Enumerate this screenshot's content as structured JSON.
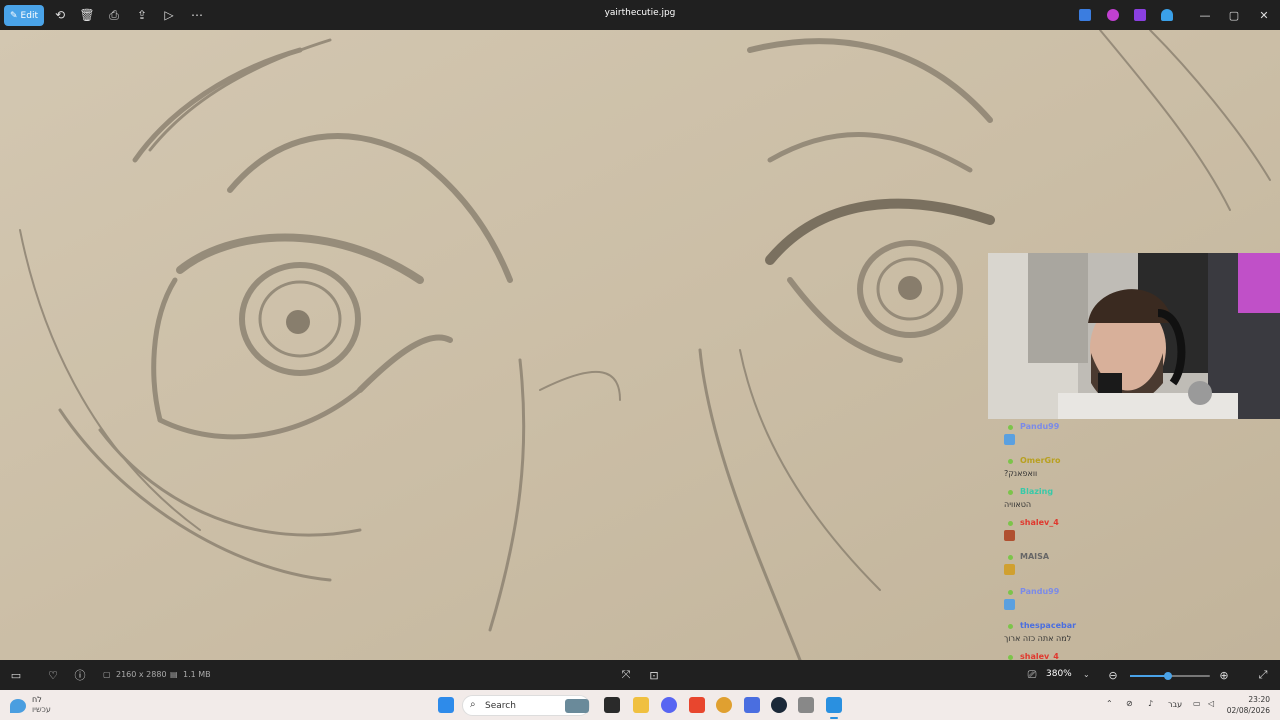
{
  "window": {
    "title": "yairthecutie.jpg",
    "edit_label": "Edit"
  },
  "toolbar_icons": [
    "rotate-icon",
    "delete-icon",
    "print-icon",
    "share-icon",
    "slideshow-icon",
    "more-icon"
  ],
  "info": {
    "dimensions": "2160 x 2880",
    "size": "1.1 MB",
    "zoom": "380%",
    "zoom_level": 0.47
  },
  "chat": {
    "messages": [
      {
        "user": "Pandu99",
        "text": "",
        "color": "#7b8be8",
        "emote": "#5aa0e0"
      },
      {
        "user": "OmerGro",
        "text": "וואפאנק?",
        "color": "#b8a020",
        "emote": ""
      },
      {
        "user": "Blazing",
        "text": "הטאוויה",
        "color": "#38c9a8",
        "emote": ""
      },
      {
        "user": "shalev_4",
        "text": "",
        "color": "#e0382e",
        "emote": "#b05030"
      },
      {
        "user": "MAISA",
        "text": "",
        "color": "#666666",
        "emote": "#d0a030"
      },
      {
        "user": "Pandu99",
        "text": "",
        "color": "#7b8be8",
        "emote": "#5aa0e0"
      },
      {
        "user": "thespacebar",
        "text": "למה אתה כזה ארוך",
        "color": "#4a6ee0",
        "emote": ""
      },
      {
        "user": "shalev_4",
        "text": "",
        "color": "#e0382e",
        "emote": ""
      }
    ]
  },
  "taskbar": {
    "search_placeholder": "Search",
    "weather_line1": "לח",
    "weather_line2": "עכשיו",
    "lang": "עבר",
    "time": "23:20",
    "date": "02/08/2026"
  }
}
